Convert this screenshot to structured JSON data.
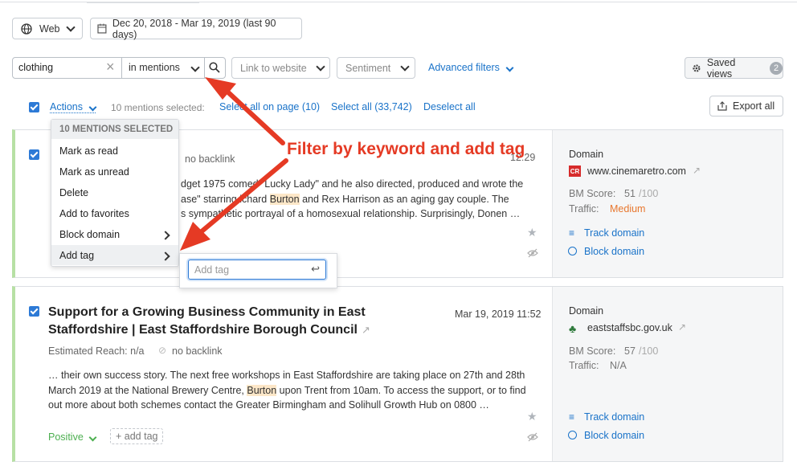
{
  "toolbar": {
    "web_label": "Web",
    "date_range": "Dec 20, 2018 - Mar 19, 2019 (last 90 days)"
  },
  "filters": {
    "keyword_value": "clothing",
    "mention_scope": "in mentions",
    "link_placeholder": "Link to website",
    "sentiment_placeholder": "Sentiment",
    "advanced_filters": "Advanced filters",
    "saved_views_label": "Saved views",
    "saved_views_count": "2"
  },
  "actions_bar": {
    "actions_label": "Actions",
    "selected_text": "10 mentions selected:",
    "select_page": "Select all on page (10)",
    "select_all": "Select all (33,742)",
    "deselect_all": "Deselect all",
    "export_all": "Export all"
  },
  "menu": {
    "header": "10 MENTIONS SELECTED",
    "items": [
      "Mark as read",
      "Mark as unread",
      "Delete",
      "Add to favorites",
      "Block domain",
      "Add tag"
    ],
    "tag_placeholder": "Add tag"
  },
  "annotation": "Filter by keyword and add tag",
  "cards": [
    {
      "no_backlink": "no backlink",
      "date_fragment": "12:29",
      "excerpt_l1": "dget 1975 comed“ Lucky Lady\" and he also directed, produced and wrote the",
      "excerpt_l2_a": "ase\" starring ",
      "excerpt_l2_b": "ichard ",
      "excerpt_l2_hl": "Burton",
      "excerpt_l2_c": " and Rex Harrison as an aging gay couple. The",
      "excerpt_l3": "s sympathetic portrayal of a homosexual relationship. Surprisingly, Donen …",
      "domain_label": "Domain",
      "domain": "www.cinemaretro.com",
      "bm_label": "BM Score:",
      "bm_value": "51",
      "bm_max": "/100",
      "traffic_label": "Traffic:",
      "traffic_value": "Medium",
      "track": "Track domain",
      "block": "Block domain"
    },
    {
      "title_l1": "Support for a Growing Business Community in East",
      "title_l2": "Staffordshire | East Staffordshire Borough Council",
      "date": "Mar 19, 2019 11:52",
      "reach": "Estimated Reach: n/a",
      "no_backlink": "no backlink",
      "excerpt_l1": "… their own success story. The next free workshops in East Staffordshire are taking place on 27th and 28th",
      "excerpt_l2_a": "March 2019 at the National Brewery Centre, ",
      "excerpt_l2_hl": "Burton",
      "excerpt_l2_b": " upon Trent from 10am. To access the support, or to find",
      "excerpt_l3": "out more about both schemes contact the Greater Birmingham and Solihull Growth Hub on 0800 …",
      "sentiment": "Positive",
      "add_tag": "+ add tag",
      "domain_label": "Domain",
      "domain": "eaststaffsbc.gov.uk",
      "bm_label": "BM Score:",
      "bm_value": "57",
      "bm_max": "/100",
      "traffic_label": "Traffic:",
      "traffic_value": "N/A",
      "track": "Track domain",
      "block": "Block domain"
    }
  ],
  "colors": {
    "accent": "#1a73c9",
    "annotation": "#e53a24",
    "positive": "#4caf50",
    "traffic_medium": "#e8772e"
  }
}
